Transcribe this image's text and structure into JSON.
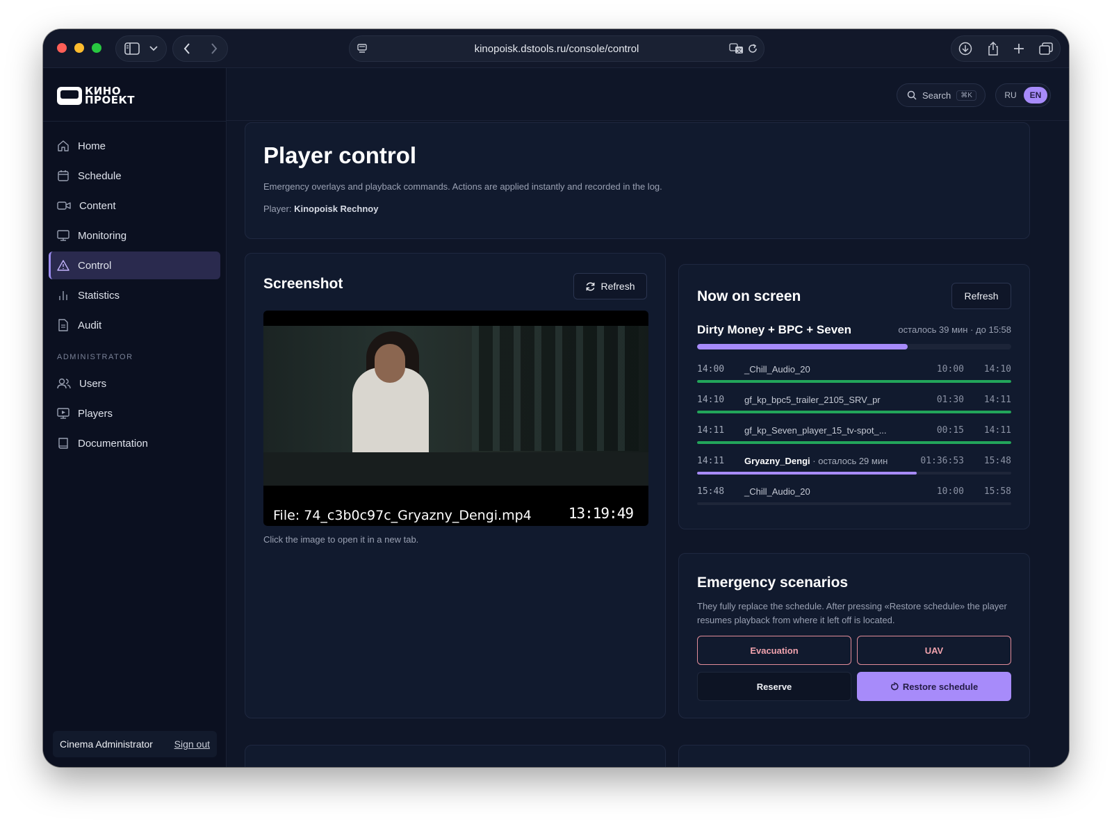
{
  "browser": {
    "url": "kinopoisk.dstools.ru/console/control"
  },
  "sidebar": {
    "logo_line1": "КИНО",
    "logo_line2": "ПРОЕКТ",
    "items": [
      {
        "label": "Home",
        "icon": "home-icon"
      },
      {
        "label": "Schedule",
        "icon": "calendar-icon"
      },
      {
        "label": "Content",
        "icon": "video-icon"
      },
      {
        "label": "Monitoring",
        "icon": "monitor-icon"
      },
      {
        "label": "Control",
        "icon": "warning-triangle-icon",
        "active": true
      },
      {
        "label": "Statistics",
        "icon": "bar-chart-icon"
      },
      {
        "label": "Audit",
        "icon": "document-icon"
      }
    ],
    "admin_section": "ADMINISTRATOR",
    "admin_items": [
      {
        "label": "Users",
        "icon": "users-icon"
      },
      {
        "label": "Players",
        "icon": "player-screen-icon"
      },
      {
        "label": "Documentation",
        "icon": "book-icon"
      }
    ],
    "user_name": "Cinema Administrator",
    "sign_out": "Sign out"
  },
  "topbar": {
    "search_label": "Search",
    "search_shortcut": "⌘K",
    "lang_ru": "RU",
    "lang_en": "EN",
    "lang_selected": "EN"
  },
  "header": {
    "title": "Player control",
    "description": "Emergency overlays and playback commands. Actions are applied instantly and recorded in the log.",
    "player_label": "Player:",
    "player_name": "Kinopoisk Rechnoy"
  },
  "screenshot": {
    "title": "Screenshot",
    "refresh_label": "Refresh",
    "file_caption": "File: 74_c3b0c97c_Gryazny_Dengi.mp4",
    "time_overlay": "13:19:49",
    "hint": "Click the image to open it in a new tab."
  },
  "now_on_screen": {
    "title": "Now on screen",
    "refresh_label": "Refresh",
    "current": "Dirty Money + BPC + Seven",
    "remaining": "осталось 39 мин · до 15:58",
    "progress": 0.67,
    "playlist": [
      {
        "start": "14:00",
        "name": "_Chill_Audio_20",
        "sub": "",
        "duration": "10:00",
        "end": "14:10",
        "progress": 1.0,
        "state": "done"
      },
      {
        "start": "14:10",
        "name": "gf_kp_bpc5_trailer_2105_SRV_pr",
        "sub": "",
        "duration": "01:30",
        "end": "14:11",
        "progress": 1.0,
        "state": "done"
      },
      {
        "start": "14:11",
        "name": "gf_kp_Seven_player_15_tv-spot_...",
        "sub": "",
        "duration": "00:15",
        "end": "14:11",
        "progress": 1.0,
        "state": "done"
      },
      {
        "start": "14:11",
        "name": "Gryazny_Dengi",
        "sub": " · осталось 29 мин",
        "duration": "01:36:53",
        "end": "15:48",
        "progress": 0.7,
        "state": "current"
      },
      {
        "start": "15:48",
        "name": "_Chill_Audio_20",
        "sub": "",
        "duration": "10:00",
        "end": "15:58",
        "progress": 0.0,
        "state": "upcoming"
      }
    ]
  },
  "emergency": {
    "title": "Emergency scenarios",
    "description": "They fully replace the schedule. After pressing «Restore schedule» the player resumes playback from where it left off is located.",
    "evacuation_label": "Evacuation",
    "uav_label": "UAV",
    "reserve_label": "Reserve",
    "restore_label": "Restore schedule"
  },
  "colors": {
    "accent": "#a78bfa",
    "done": "#22a55a",
    "danger": "#e38d9a",
    "background": "#0f1628"
  }
}
